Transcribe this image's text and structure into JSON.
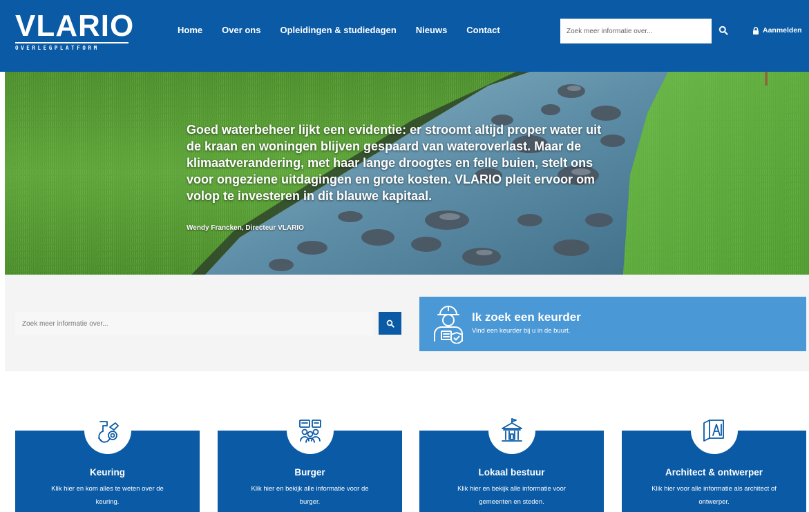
{
  "header": {
    "logo_main": "VLARIO",
    "logo_sub": "OVERLEGPLATFORM",
    "nav": [
      {
        "label": "Home"
      },
      {
        "label": "Over ons"
      },
      {
        "label": "Opleidingen & studiedagen"
      },
      {
        "label": "Nieuws"
      },
      {
        "label": "Contact"
      }
    ],
    "search_placeholder": "Zoek meer informatie over...",
    "search_icon": "search-icon",
    "login_icon": "lock-icon",
    "login_label": "Aanmelden"
  },
  "hero": {
    "quote": "Goed waterbeheer lijkt een evidentie: er stroomt altijd proper water uit de kraan en woningen blijven gespaard van wateroverlast. Maar de klimaatverandering, met haar lange droogtes en felle buien, stelt ons voor ongeziene uitdagingen en grote kosten. VLARIO pleit ervoor om volop te investeren in dit blauwe kapitaal.",
    "author": "Wendy Francken, Directeur VLARIO"
  },
  "search": {
    "placeholder": "Zoek meer informatie over...",
    "button_icon": "search-icon"
  },
  "keurder": {
    "icon": "inspector-icon",
    "title": "Ik zoek een keurder",
    "subtitle": "Vind een keurder bij u in de buurt."
  },
  "cards": [
    {
      "icon": "sewer-pipe-icon",
      "title": "Keuring",
      "desc": "Klik hier en kom alles te weten over de keuring."
    },
    {
      "icon": "citizens-icon",
      "title": "Burger",
      "desc": "Klik hier en bekijk alle informatie voor de burger."
    },
    {
      "icon": "town-hall-icon",
      "title": "Lokaal bestuur",
      "desc": "Klik hier en bekijk alle informatie voor gemeenten en steden."
    },
    {
      "icon": "blueprint-icon",
      "title": "Architect & ontwerper",
      "desc": "Klik hier voor alle informatie als architect of ontwerper."
    }
  ],
  "colors": {
    "brand_blue": "#0a5aa5",
    "light_blue": "#4a98d6",
    "band_grey": "#f4f4f5"
  }
}
